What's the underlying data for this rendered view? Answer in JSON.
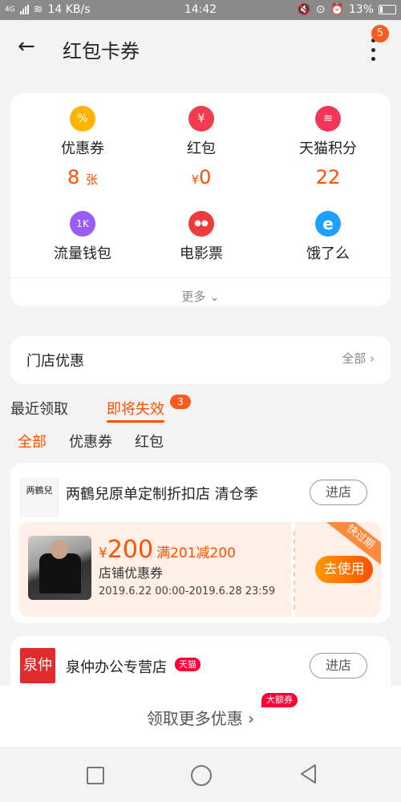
{
  "status_bar": {
    "net": "4G",
    "speed": "14 KB/s",
    "time": "14:42",
    "battery": "13%"
  },
  "header": {
    "title": "红包卡券",
    "notification_count": "5"
  },
  "wallet": {
    "row1": [
      {
        "label": "优惠券",
        "value": "8",
        "unit": "张",
        "icon": "coupon-icon",
        "color": "#ffb400",
        "glyph": "%"
      },
      {
        "label": "红包",
        "value": "0",
        "prefix": "¥",
        "icon": "red-packet-icon",
        "color": "#f23d4f",
        "glyph": "¥"
      },
      {
        "label": "天猫积分",
        "value": "22",
        "icon": "points-icon",
        "color": "#f2355a",
        "glyph": "≋"
      }
    ],
    "row2": [
      {
        "label": "流量钱包",
        "icon": "data-wallet-icon",
        "color": "#9a5cf5",
        "glyph": "1K"
      },
      {
        "label": "电影票",
        "icon": "movie-ticket-icon",
        "color": "#ef3b3b",
        "glyph": "●●"
      },
      {
        "label": "饿了么",
        "icon": "eleme-icon",
        "color": "#1ea0ff",
        "glyph": "e"
      }
    ],
    "more_label": "更多"
  },
  "store_offer": {
    "label": "门店优惠",
    "all_label": "全部"
  },
  "tabs": {
    "recent": "最近领取",
    "expiring": "即将失效",
    "expiring_count": "3"
  },
  "subtabs": {
    "all": "全部",
    "coupons": "优惠券",
    "red_packets": "红包"
  },
  "coupon1": {
    "shop_name": "两鶴兒原单定制折扣店 清仓季",
    "logo_text": "两鶴兒",
    "enter_label": "进店",
    "currency": "¥",
    "amount": "200",
    "condition": "满201减200",
    "type": "店铺优惠券",
    "date_range": "2019.6.22 00:00-2019.6.28 23:59",
    "use_label": "去使用",
    "ribbon": "快过期"
  },
  "coupon2": {
    "shop_name": "泉仲办公专营店",
    "logo_text": "泉仲",
    "tag": "天猫",
    "enter_label": "进店"
  },
  "more_offers": {
    "label": "领取更多优惠",
    "tag": "大额券"
  }
}
